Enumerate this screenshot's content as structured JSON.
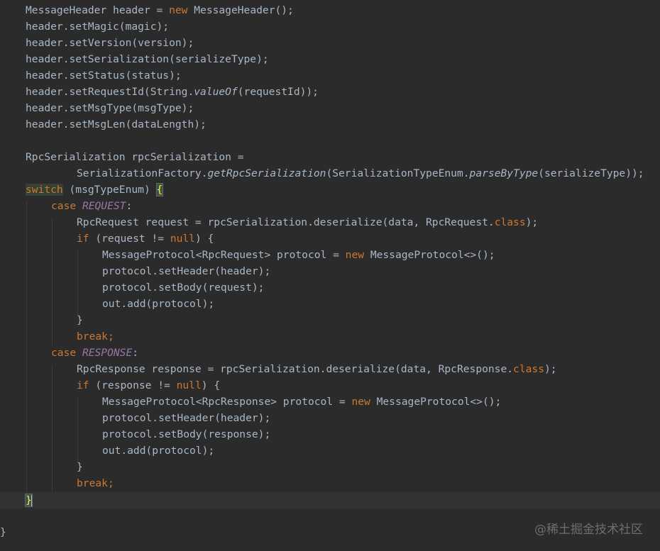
{
  "code": {
    "header_decl": {
      "type": "MessageHeader",
      "var": "header",
      "eq": " = ",
      "kw_new": "new",
      "ctor": " MessageHeader();"
    },
    "set_magic": "header.setMagic(magic);",
    "set_version": "header.setVersion(version);",
    "set_serialization": "header.setSerialization(serializeType);",
    "set_status": "header.setStatus(status);",
    "set_request_id": {
      "prefix": "header.setRequestId(String.",
      "method": "valueOf",
      "suffix": "(requestId));"
    },
    "set_msg_type": "header.setMsgType(msgType);",
    "set_msg_len": "header.setMsgLen(dataLength);",
    "rpc_decl": "RpcSerialization rpcSerialization =",
    "factory_line": {
      "prefix": "SerializationFactory.",
      "method1": "getRpcSerialization",
      "middle": "(SerializationTypeEnum.",
      "method2": "parseByType",
      "suffix": "(serializeType));"
    },
    "switch_line": {
      "kw": "switch",
      "expr": " (msgTypeEnum) ",
      "brace": "{"
    },
    "case_request": {
      "kw": "case",
      "label": "REQUEST",
      "colon": ":"
    },
    "request_deser": {
      "text": "RpcRequest request = rpcSerialization.deserialize(data, RpcRequest.",
      "kw": "class",
      "end": ");"
    },
    "if_request": {
      "kw": "if",
      "mid": " (request != ",
      "null": "null",
      "end": ") {"
    },
    "req_protocol_decl": {
      "text": "MessageProtocol<RpcRequest> protocol = ",
      "kw": "new",
      "end": " MessageProtocol<>();"
    },
    "req_set_header": "protocol.setHeader(header);",
    "req_set_body": "protocol.setBody(request);",
    "req_out_add": "out.add(protocol);",
    "close_brace": "}",
    "break_kw": "break",
    "semicolon": ";",
    "case_response": {
      "kw": "case",
      "label": "RESPONSE",
      "colon": ":"
    },
    "response_deser": {
      "text": "RpcResponse response = rpcSerialization.deserialize(data, RpcResponse.",
      "kw": "class",
      "end": ");"
    },
    "if_response": {
      "kw": "if",
      "mid": " (response != ",
      "null": "null",
      "end": ") {"
    },
    "resp_protocol_decl": {
      "text": "MessageProtocol<RpcResponse> protocol = ",
      "kw": "new",
      "end": " MessageProtocol<>();"
    },
    "resp_set_header": "protocol.setHeader(header);",
    "resp_set_body": "protocol.setBody(response);",
    "resp_out_add": "out.add(protocol);",
    "switch_close": "}",
    "method_close": "}"
  },
  "watermark": "@稀土掘金技术社区",
  "colors": {
    "background": "#2b2b2b",
    "text": "#a9b7c6",
    "keyword": "#cc7832",
    "enum_constant": "#9876aa",
    "brace_match": "#ffef28"
  }
}
